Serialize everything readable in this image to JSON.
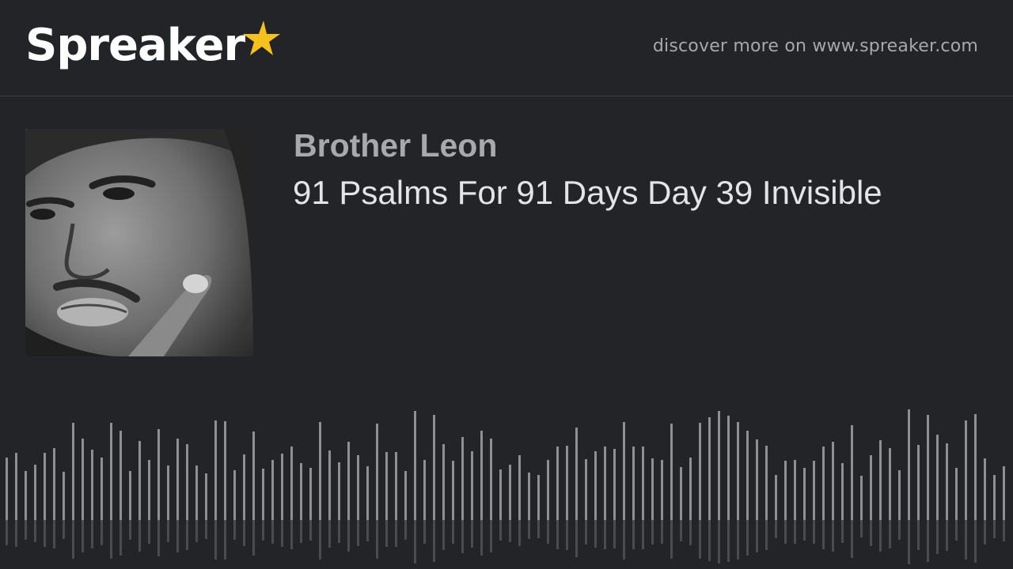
{
  "brand": {
    "name": "Spreaker",
    "star_color": "#f5c11c",
    "text_color": "#ffffff"
  },
  "header": {
    "discover_text": "discover more on www.spreaker.com"
  },
  "episode": {
    "author": "Brother Leon",
    "title": "91 Psalms For 91 Days Day 39 Invisible"
  },
  "waveform": {
    "bar_color": "#8e8f93",
    "reflection_color": "#4a4b4f"
  }
}
